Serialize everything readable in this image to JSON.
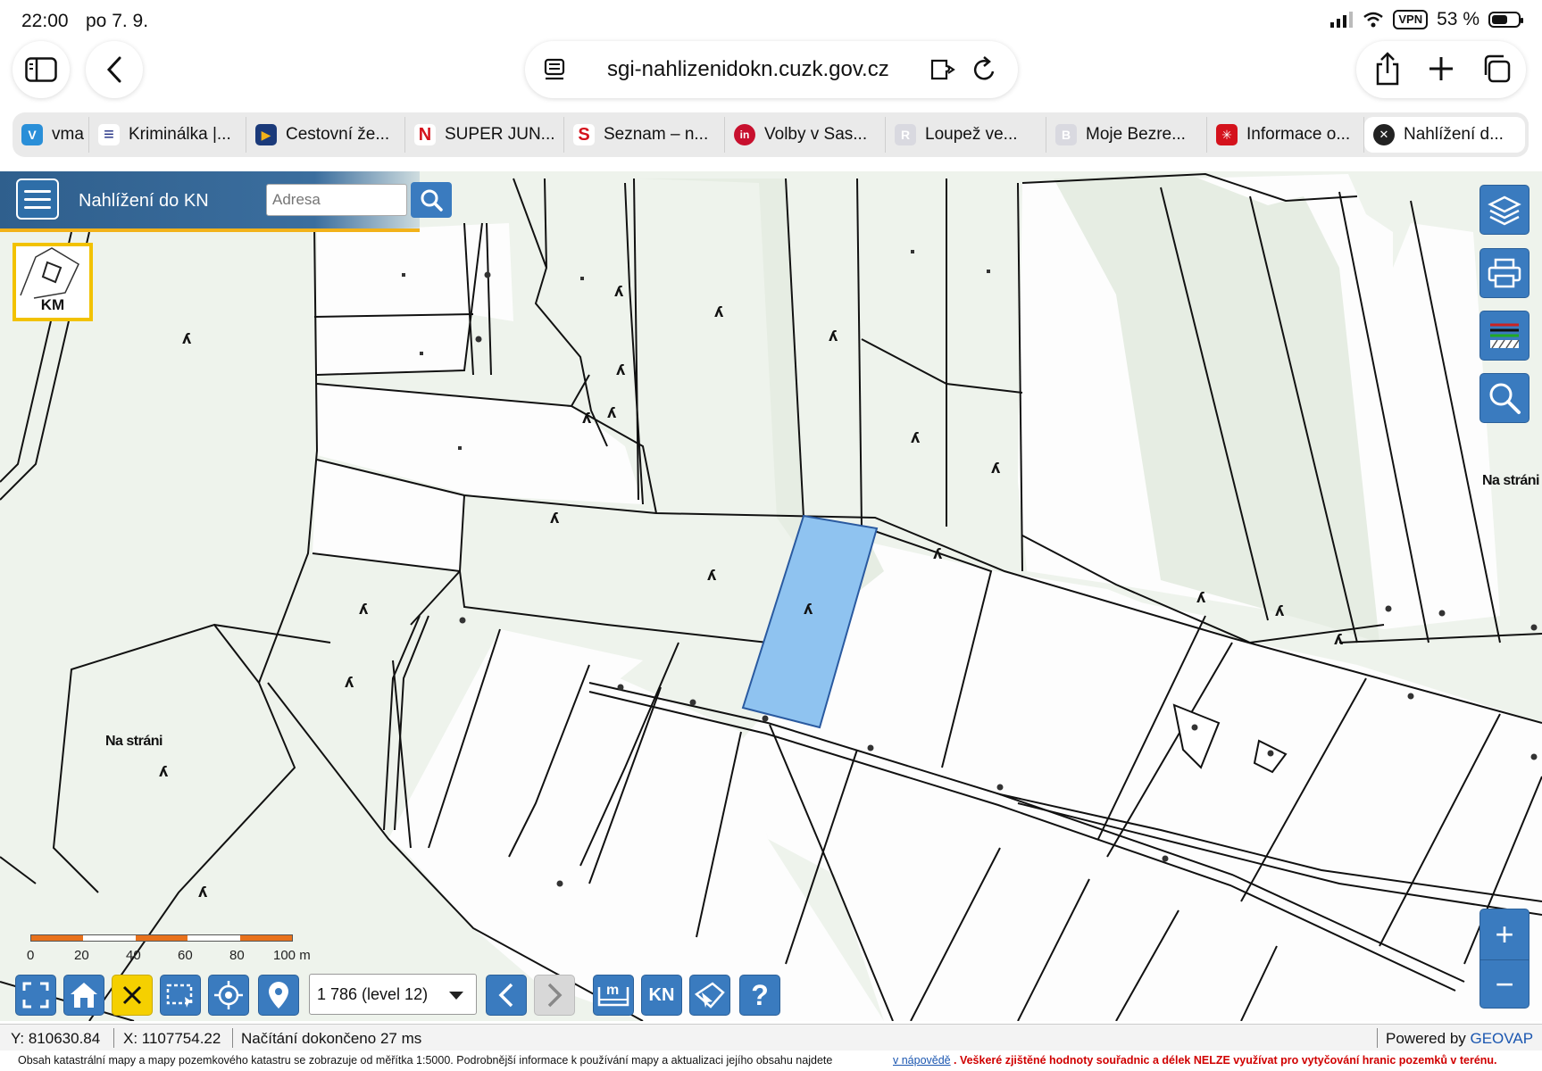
{
  "statusbar": {
    "time": "22:00",
    "date": "po 7. 9.",
    "vpn": "VPN",
    "battery": "53 %"
  },
  "browser": {
    "url": "sgi-nahlizenidokn.cuzk.gov.cz",
    "tabs": [
      {
        "label": "vma",
        "fav_color": "#2a8fd8",
        "fav_text": "V"
      },
      {
        "label": "Kriminálka |...",
        "fav_color": "#1b2a80",
        "fav_text": "≡"
      },
      {
        "label": "Cestovní že...",
        "fav_color": "#1b3a7a",
        "fav_text": "▶"
      },
      {
        "label": "SUPER JUN...",
        "fav_color": "#ffffff",
        "fav_text": "N"
      },
      {
        "label": "Seznam – n...",
        "fav_color": "#ffffff",
        "fav_text": "S"
      },
      {
        "label": "Volby v Sas...",
        "fav_color": "#c8102e",
        "fav_text": "in"
      },
      {
        "label": "Loupež ve...",
        "fav_color": "#cfcfd8",
        "fav_text": "R"
      },
      {
        "label": "Moje Bezre...",
        "fav_color": "#cfcfd8",
        "fav_text": "B"
      },
      {
        "label": "Informace o...",
        "fav_color": "#d4121c",
        "fav_text": "✳"
      },
      {
        "label": "Nahlížení d...",
        "fav_color": "#222222",
        "fav_text": "✕"
      }
    ]
  },
  "app": {
    "title": "Nahlížení do KN",
    "search_placeholder": "Adresa",
    "km_label": "KM",
    "map_labels": [
      "Na stráni",
      "Na stráni"
    ],
    "scale_ticks": [
      "0",
      "20",
      "40",
      "60",
      "80",
      "100 m"
    ],
    "scale_select": "1 786 (level 12)",
    "zoom_in": "+",
    "zoom_out": "−",
    "kn_label": "KN",
    "help_label": "?"
  },
  "mapstatus": {
    "y": "Y: 810630.84",
    "x": "X: 1107754.22",
    "loading": "Načítání dokončeno 27 ms",
    "powered_prefix": "Powered by ",
    "powered_brand": "GEOVAP"
  },
  "footnote": {
    "text": "Obsah katastrální mapy a mapy pozemkového katastru se zobrazuje od měřítka 1:5000. Podrobnější informace k používání mapy a aktualizaci jejího obsahu najdete",
    "link": "v nápovědě",
    "warning": ". Veškeré zjištěné hodnoty souřadnic a délek NELZE využívat pro vytyčování hranic pozemků v terénu."
  },
  "colors": {
    "header": "#3b6e9e",
    "accent": "#f2b21a",
    "tool_blue": "#3a7bbf",
    "selected_parcel": "#8fc3f0",
    "map_green": "#eef3ec",
    "warning": "#d00000",
    "brand_blue": "#1a56b0"
  }
}
